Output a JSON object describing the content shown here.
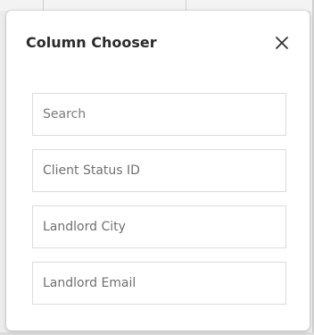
{
  "dialog": {
    "title": "Column Chooser",
    "close_icon": "close-icon"
  },
  "search": {
    "placeholder": "Search",
    "value": ""
  },
  "columns": [
    {
      "label": "Client Status ID"
    },
    {
      "label": "Landlord City"
    },
    {
      "label": "Landlord Email"
    }
  ],
  "colors": {
    "title": "#2b2b2b",
    "item_text": "#6f6f6f",
    "border": "#dcdcdc",
    "overlay": "#ececec"
  }
}
